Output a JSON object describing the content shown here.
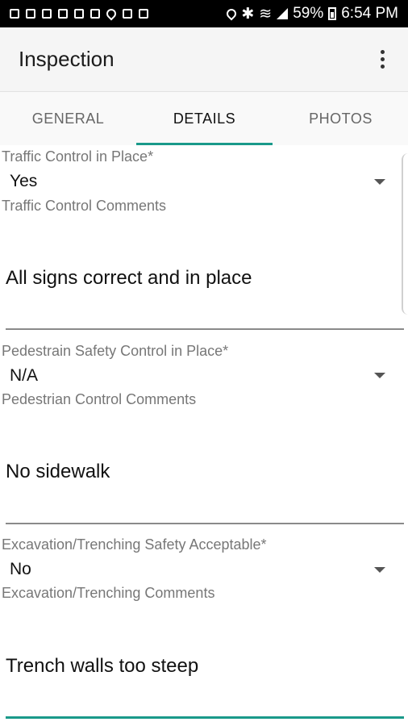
{
  "status_bar": {
    "battery": "59%",
    "time": "6:54 PM"
  },
  "app_bar": {
    "title": "Inspection"
  },
  "tabs": [
    {
      "label": "GENERAL"
    },
    {
      "label": "DETAILS"
    },
    {
      "label": "PHOTOS"
    }
  ],
  "form": {
    "traffic": {
      "select_label": "Traffic Control in Place*",
      "select_value": "Yes",
      "comments_label": "Traffic Control Comments",
      "comments_value": "All signs correct and in place"
    },
    "pedestrian": {
      "select_label": "Pedestrain Safety Control in Place*",
      "select_value": "N/A",
      "comments_label": "Pedestrian Control Comments",
      "comments_value": "No sidewalk"
    },
    "excavation": {
      "select_label": "Excavation/Trenching Safety Acceptable*",
      "select_value": "No",
      "comments_label": "Excavation/Trenching Comments",
      "comments_value": "Trench walls too steep"
    }
  },
  "colors": {
    "accent": "#1a9a8a",
    "status_bar": "#000000",
    "app_bar": "#f5f5f5"
  }
}
